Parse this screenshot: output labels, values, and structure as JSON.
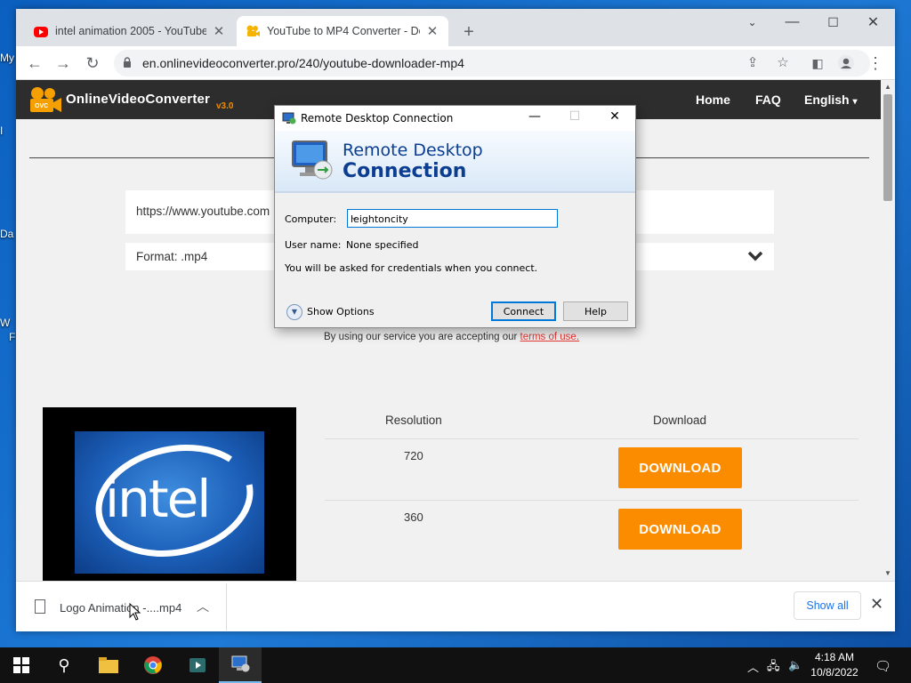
{
  "desktop": {
    "icon_labels": [
      "My",
      "I",
      "Da",
      "W",
      "F"
    ]
  },
  "browser": {
    "tabs": [
      {
        "title": "intel animation 2005 - YouTube",
        "icon": "youtube-icon"
      },
      {
        "title": "YouTube to MP4 Converter - Do",
        "icon": "converter-icon"
      }
    ],
    "address": "en.onlinevideoconverter.pro/240/youtube-downloader-mp4"
  },
  "site": {
    "logo_text": "OnlineVideoConverter",
    "logo_badge": "OVC",
    "version": "v3.0",
    "nav": [
      "Home",
      "FAQ",
      "English"
    ],
    "url_value": "https://www.youtube.com",
    "format_label": "Format: .mp4",
    "terms_text": "By using our service you are accepting our",
    "terms_link": "terms of use.",
    "table": {
      "headers": [
        "Resolution",
        "Download"
      ],
      "rows": [
        {
          "resolution": "720",
          "button": "DOWNLOAD"
        },
        {
          "resolution": "360",
          "button": "DOWNLOAD"
        }
      ]
    },
    "thumbnail_text": "intel"
  },
  "downloads": {
    "item_name": "Logo Animation -....mp4",
    "show_all": "Show all"
  },
  "rdp": {
    "title": "Remote Desktop Connection",
    "banner_line1": "Remote Desktop",
    "banner_line2": "Connection",
    "computer_label": "Computer:",
    "computer_value": "leightoncity",
    "username_label": "User name:",
    "username_value": "None specified",
    "info": "You will be asked for credentials when you connect.",
    "show_options": "Show Options",
    "connect": "Connect",
    "help": "Help"
  },
  "taskbar": {
    "time": "4:18 AM",
    "date": "10/8/2022"
  },
  "colors": {
    "accent_orange": "#fb8c00",
    "rdp_blue": "#0b3d91",
    "taskbar": "#111111"
  }
}
